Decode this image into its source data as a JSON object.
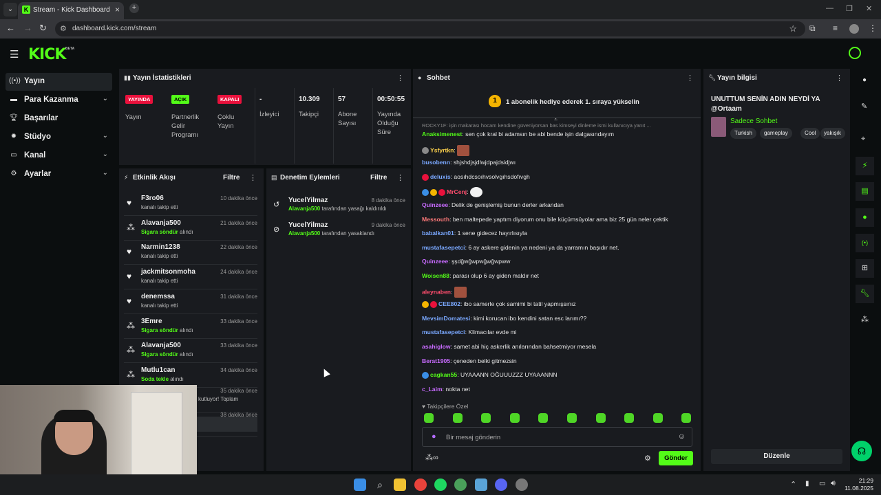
{
  "browser": {
    "tab_title": "Stream - Kick Dashboard",
    "url": "dashboard.kick.com/stream"
  },
  "header": {
    "logo": "KICK",
    "beta": "BETA"
  },
  "sidebar": {
    "items": [
      {
        "label": "Yayın",
        "icon": "broadcast-icon",
        "active": true
      },
      {
        "label": "Para Kazanma",
        "icon": "money-icon",
        "chevron": true
      },
      {
        "label": "Başarılar",
        "icon": "trophy-icon"
      },
      {
        "label": "Stüdyo",
        "icon": "palette-icon",
        "chevron": true
      },
      {
        "label": "Kanal",
        "icon": "channel-icon",
        "chevron": true
      },
      {
        "label": "Ayarlar",
        "icon": "gear-icon",
        "chevron": true
      }
    ]
  },
  "stats": {
    "title": "Yayın İstatistikleri",
    "cards": [
      {
        "badge": "YAYINDA",
        "label": "Yayın",
        "color": "#e9113c"
      },
      {
        "badge": "AÇIK",
        "label": "Partnerlik Gelir Programı",
        "color": "#53fc18"
      },
      {
        "badge": "KAPALI",
        "label": "Çoklu Yayın",
        "color": "#e9113c"
      },
      {
        "value": "-",
        "label": "İzleyici"
      },
      {
        "value": "10.309",
        "label": "Takipçi"
      },
      {
        "value": "57",
        "label": "Abone Sayısı"
      },
      {
        "value": "00:50:55",
        "label": "Yayında Olduğu Süre"
      }
    ]
  },
  "activity": {
    "title": "Etkinlik Akışı",
    "filter": "Filtre",
    "items": [
      {
        "name": "F3ro06",
        "sub": "kanalı takip etti",
        "time": "10 dakika önce",
        "type": "follow"
      },
      {
        "name": "Alavanja500",
        "highlight": "Sigara söndür",
        "sub": "alındı",
        "time": "21 dakika önce",
        "type": "reward"
      },
      {
        "name": "Narmin1238",
        "sub": "kanalı takip etti",
        "time": "22 dakika önce",
        "type": "follow"
      },
      {
        "name": "jackmitsonmoha",
        "sub": "kanalı takip etti",
        "time": "24 dakika önce",
        "type": "follow"
      },
      {
        "name": "denemssa",
        "sub": "kanalı takip etti",
        "time": "31 dakika önce",
        "type": "follow"
      },
      {
        "name": "3Emre",
        "highlight": "Sigara söndür",
        "sub": "alındı",
        "time": "33 dakika önce",
        "type": "reward"
      },
      {
        "name": "Alavanja500",
        "highlight": "Sigara söndür",
        "sub": "alındı",
        "time": "33 dakika önce",
        "type": "reward"
      },
      {
        "name": "Mutlu1can",
        "highlight": "Soda tekle",
        "sub": "alındı",
        "time": "34 dakika önce",
        "type": "reward"
      },
      {
        "name": "",
        "sub": "kutluyor! Toplam",
        "time": "35 dakika önce",
        "type": "gift"
      },
      {
        "name": "",
        "sub": "kutluyor! Toplam",
        "time": "38 dakika önce",
        "type": "gift"
      }
    ]
  },
  "moderation": {
    "title": "Denetim Eylemleri",
    "filter": "Filtre",
    "items": [
      {
        "name": "YucelYilmaz",
        "actor": "Alavanja500",
        "sub": "tarafından yasağı kaldırıldı",
        "time": "8 dakika önce"
      },
      {
        "name": "YucelYilmaz",
        "actor": "Alavanja500",
        "sub": "tarafından yasaklandı",
        "time": "9 dakika önce"
      }
    ]
  },
  "chat": {
    "title": "Sohbet",
    "pinned_badge": "1",
    "pinned": "1 abonelik hediye ederek 1. sıraya yükselin",
    "cut_line": "ROCKY1F: işin makarası hocam kendine güveniyorsan bas kimseyi dinleme ismi kullanıcıya yanıt ...",
    "messages": [
      {
        "user": "Anaksimenest",
        "color": "#53fc18",
        "text": "sen çok kral bi adamsın be abi bende işin dalgasındayım"
      },
      {
        "user": "Ysfyrtkn",
        "color": "#ffd34d",
        "text": "",
        "emote": true
      },
      {
        "user": "busobenn",
        "color": "#7aa8ff",
        "text": "shjshdjsjdlwjdpajdsidjwı"
      },
      {
        "user": "deluxis",
        "color": "#7aa8ff",
        "text": "aosıhdcsoıhvsolvgıhsdofıvgh"
      },
      {
        "user": "MrCenj",
        "color": "#ff4d6d",
        "text": "",
        "sticker": true
      },
      {
        "user": "Quinzeee",
        "color": "#c86bff",
        "text": "Delik de genişlemiş bunun derler arkandan"
      },
      {
        "user": "Messouth",
        "color": "#ff7a7a",
        "text": "ben maltepede yaptım diyorum onu bile küçümsüyolar ama biz 25 gün neler çektik"
      },
      {
        "user": "babalkan01",
        "color": "#7aa8ff",
        "text": "1 sene gidecez hayırlısıyla"
      },
      {
        "user": "mustafasepetci",
        "color": "#7aa8ff",
        "text": "6 ay askere gidenin ya nedeni ya da yarramın başıdır net."
      },
      {
        "user": "Quinzeee",
        "color": "#c86bff",
        "text": "şşdğwğwpwğwğwpww"
      },
      {
        "user": "Woisen88",
        "color": "#53fc18",
        "text": "parası olup 6 ay giden maldır net"
      },
      {
        "user": "aleynaben",
        "color": "#ff4d6d",
        "text": "",
        "emote": true
      },
      {
        "user": "CEE802",
        "color": "#7aa8ff",
        "text": "ibo samerle çok samimi bi tatil yapmışsınız"
      },
      {
        "user": "MevsimDomatesi",
        "color": "#7aa8ff",
        "text": "kimi korucan ibo kendini satan esc larımı??"
      },
      {
        "user": "mustafasepetci",
        "color": "#7aa8ff",
        "text": "Klimacılar evde mi"
      },
      {
        "user": "asahiglow",
        "color": "#c86bff",
        "text": "samet abi hiç askerlik anılarından bahsetmiyor mesela"
      },
      {
        "user": "Berat1905",
        "color": "#c86bff",
        "text": "çeneden belki gitmezsin"
      },
      {
        "user": "cagkan55",
        "color": "#53fc18",
        "text": "UYAAANN OĞUUUZZZ UYAAANNN"
      },
      {
        "user": "c_Laim",
        "color": "#c86bff",
        "text": "nokta net"
      }
    ],
    "followers_only": "Takipçilere Özel",
    "input_placeholder": "Bir mesaj gönderin",
    "send": "Gönder"
  },
  "info": {
    "title": "Yayın bilgisi",
    "stream_title": "UNUTTUM SENİN ADIN NEYDİ YA @Ortaam",
    "category": "Sadece Sohbet",
    "tags": [
      "Turkish",
      "gameplay",
      "Cool",
      "yakışık"
    ],
    "edit": "Düzenle"
  },
  "taskbar": {
    "time": "21:29",
    "date": "11.08.2025"
  }
}
